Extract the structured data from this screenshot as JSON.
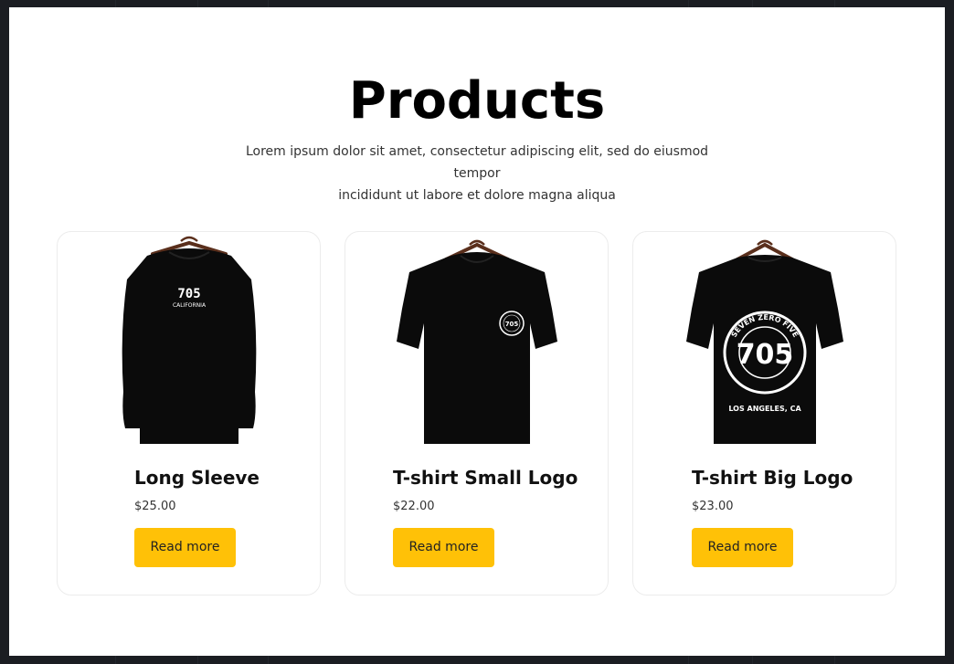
{
  "header": {
    "title": "Products",
    "subtitle_line1": "Lorem ipsum dolor sit amet, consectetur adipiscing elit, sed do eiusmod tempor",
    "subtitle_line2": "incididunt ut labore et dolore magna aliqua"
  },
  "products": [
    {
      "name": "Long Sleeve",
      "price": "$25.00",
      "button_label": "Read more",
      "image": {
        "icon": "long-sleeve-shirt-image",
        "print_line1": "705",
        "print_line2": "CALIFORNIA"
      }
    },
    {
      "name": "T-shirt Small Logo",
      "price": "$22.00",
      "button_label": "Read more",
      "image": {
        "icon": "small-logo-tshirt-image",
        "print_line1": "705"
      }
    },
    {
      "name": "T-shirt Big Logo",
      "price": "$23.00",
      "button_label": "Read more",
      "image": {
        "icon": "big-logo-tshirt-image",
        "print_line1": "705",
        "ring_text": "SEVEN ZERO FIVE",
        "print_line2": "LOS ANGELES, CA"
      }
    }
  ],
  "colors": {
    "button": "#ffc107",
    "shirt": "#0b0b0b",
    "hanger": "#5a2f1c"
  }
}
